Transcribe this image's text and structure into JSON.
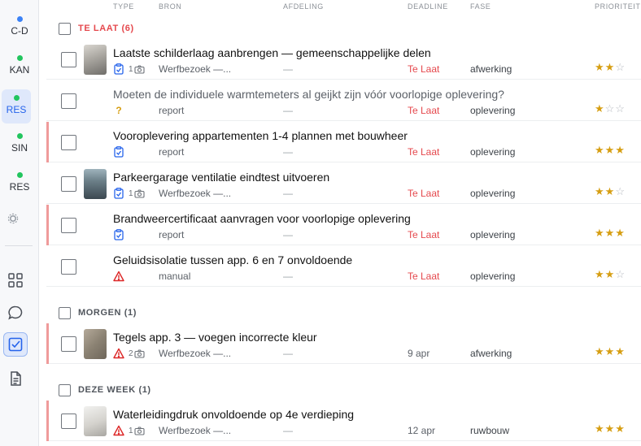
{
  "sidebar": {
    "projects": [
      {
        "label": "C-D",
        "dot": "#3b82f6"
      },
      {
        "label": "KAN",
        "dot": "#22c55e"
      },
      {
        "label": "RES",
        "dot": "#22c55e"
      },
      {
        "label": "SIN",
        "dot": "#22c55e"
      },
      {
        "label": "RES",
        "dot": "#22c55e"
      }
    ],
    "nav_icons": [
      "grid-icon",
      "chat-icon",
      "tasks-icon",
      "document-icon"
    ]
  },
  "columns": {
    "type": "TYPE",
    "bron": "BRON",
    "afdeling": "AFDELING",
    "deadline": "DEADLINE",
    "fase": "FASE",
    "prioriteit": "PRIORITEIT"
  },
  "groups": [
    {
      "label": "TE LAAT",
      "count": "(6)"
    },
    {
      "label": "MORGEN",
      "count": "(1)"
    },
    {
      "label": "DEZE WEEK",
      "count": "(1)"
    }
  ],
  "tasks": [
    {
      "title": "Laatste schilderlaag aanbrengen — gemeenschappelijke delen",
      "type_icon": "clipboard-check-icon",
      "photo_count": "1",
      "source": "Werfbezoek —...",
      "afdeling": "—",
      "deadline": "Te Laat",
      "fase": "afwerking",
      "priority": 2
    },
    {
      "title": "Moeten de individuele warmtemeters al geijkt zijn vóór voorlopige oplevering?",
      "type_icon": "question-icon",
      "type_glyph": "?",
      "photo_count": "",
      "source": "report",
      "afdeling": "—",
      "deadline": "Te Laat",
      "fase": "oplevering",
      "priority": 1
    },
    {
      "title": "Vooroplevering appartementen 1-4 plannen met bouwheer",
      "type_icon": "clipboard-check-icon",
      "photo_count": "",
      "source": "report",
      "afdeling": "—",
      "deadline": "Te Laat",
      "fase": "oplevering",
      "priority": 3
    },
    {
      "title": "Parkeergarage ventilatie eindtest uitvoeren",
      "type_icon": "clipboard-check-icon",
      "photo_count": "1",
      "source": "Werfbezoek —...",
      "afdeling": "—",
      "deadline": "Te Laat",
      "fase": "oplevering",
      "priority": 2
    },
    {
      "title": "Brandweercertificaat aanvragen voor voorlopige oplevering",
      "type_icon": "clipboard-check-icon",
      "photo_count": "",
      "source": "report",
      "afdeling": "—",
      "deadline": "Te Laat",
      "fase": "oplevering",
      "priority": 3
    },
    {
      "title": "Geluidsisolatie tussen app. 6 en 7 onvoldoende",
      "type_icon": "warning-icon",
      "photo_count": "",
      "source": "manual",
      "afdeling": "—",
      "deadline": "Te Laat",
      "fase": "oplevering",
      "priority": 2
    },
    {
      "title": "Tegels app. 3 — voegen incorrecte kleur",
      "type_icon": "warning-icon",
      "photo_count": "2",
      "source": "Werfbezoek —...",
      "afdeling": "—",
      "deadline": "9 apr",
      "fase": "afwerking",
      "priority": 3
    },
    {
      "title": "Waterleidingdruk onvoldoende op 4e verdieping",
      "type_icon": "warning-icon",
      "photo_count": "1",
      "source": "Werfbezoek —...",
      "afdeling": "—",
      "deadline": "12 apr",
      "fase": "ruwbouw",
      "priority": 3
    }
  ],
  "colors": {
    "late": "#e5484d",
    "accent": "#2563eb",
    "star": "#d69e12",
    "row_marker": "#ef9b9b"
  }
}
